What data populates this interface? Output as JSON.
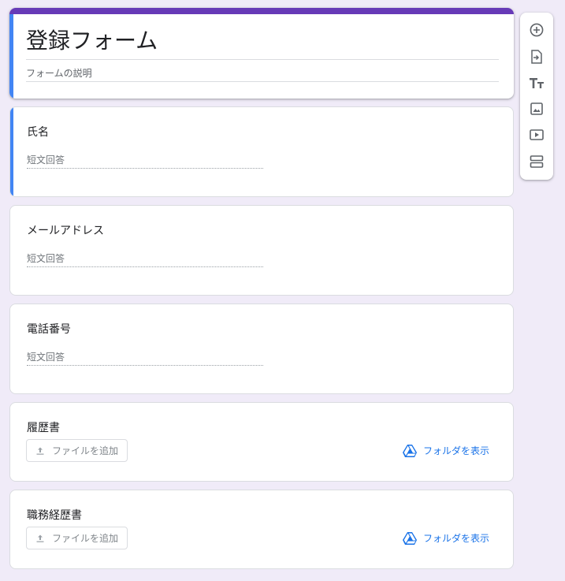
{
  "form": {
    "title": "登録フォーム",
    "description_placeholder": "フォームの説明"
  },
  "questions": [
    {
      "title": "氏名",
      "type": "short",
      "placeholder": "短文回答",
      "active": true
    },
    {
      "title": "メールアドレス",
      "type": "short",
      "placeholder": "短文回答"
    },
    {
      "title": "電話番号",
      "type": "short",
      "placeholder": "短文回答"
    },
    {
      "title": "履歴書",
      "type": "file",
      "upload_label": "ファイルを追加",
      "folder_label": "フォルダを表示"
    },
    {
      "title": "職務経歴書",
      "type": "file",
      "upload_label": "ファイルを追加",
      "folder_label": "フォルダを表示"
    }
  ],
  "toolbar": {
    "items": [
      {
        "name": "add-question",
        "icon": "add-circle-icon"
      },
      {
        "name": "import-questions",
        "icon": "import-icon"
      },
      {
        "name": "add-title",
        "icon": "title-text-icon"
      },
      {
        "name": "add-image",
        "icon": "image-icon"
      },
      {
        "name": "add-video",
        "icon": "video-icon"
      },
      {
        "name": "add-section",
        "icon": "section-icon"
      }
    ]
  },
  "colors": {
    "theme": "#673ab7",
    "accent": "#4285f4",
    "background": "#f0ebf8",
    "link": "#1a73e8"
  }
}
